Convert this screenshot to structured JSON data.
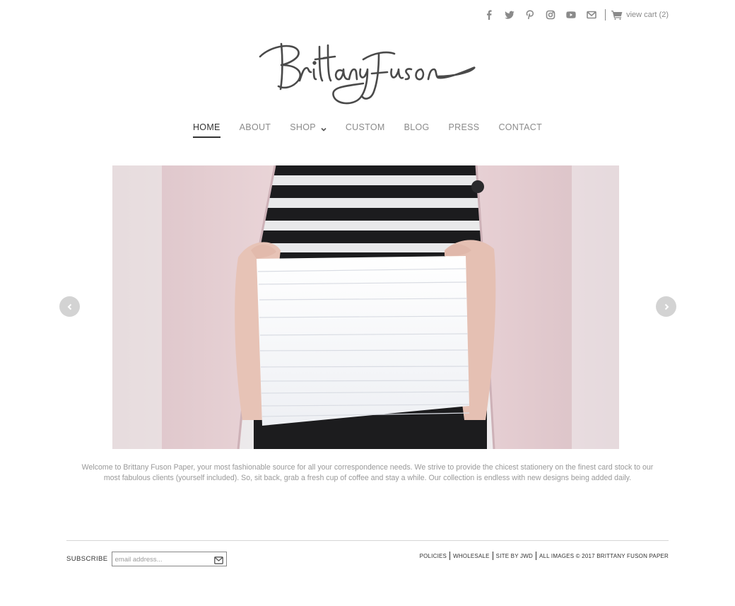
{
  "header": {
    "social": [
      {
        "name": "facebook-icon"
      },
      {
        "name": "twitter-icon"
      },
      {
        "name": "pinterest-icon"
      },
      {
        "name": "instagram-icon"
      },
      {
        "name": "youtube-icon"
      },
      {
        "name": "email-icon"
      }
    ],
    "cart_label": "view cart (2)"
  },
  "logo": {
    "text": "Brittany Fuson"
  },
  "nav": {
    "items": [
      {
        "label": "HOME",
        "active": true
      },
      {
        "label": "ABOUT"
      },
      {
        "label": "SHOP",
        "has_dropdown": true
      },
      {
        "label": "CUSTOM"
      },
      {
        "label": "BLOG"
      },
      {
        "label": "PRESS"
      },
      {
        "label": "CONTACT"
      }
    ]
  },
  "hero": {
    "prev_icon": "chevron-left-icon",
    "next_icon": "chevron-right-icon"
  },
  "intro": {
    "text": "Welcome to Brittany Fuson Paper, your most fashionable source for all your correspondence needs. We strive to provide the chicest stationery on the finest card stock to our most fabulous clients (yourself included). So, sit back, grab a fresh cup of coffee and stay a while. Our collection is endless with new designs being added daily."
  },
  "footer": {
    "subscribe_label": "SUBSCRIBE",
    "email_placeholder": "email address...",
    "links": [
      "POLICIES",
      "WHOLESALE",
      "SITE BY JWD",
      "ALL IMAGES © 2017 BRITTANY FUSON PAPER"
    ]
  },
  "colors": {
    "icon_gray": "#8a8a8a",
    "nav_active": "#333333",
    "nav_inactive": "#8b8b8b",
    "arrow_bg": "#d3d3d3"
  }
}
